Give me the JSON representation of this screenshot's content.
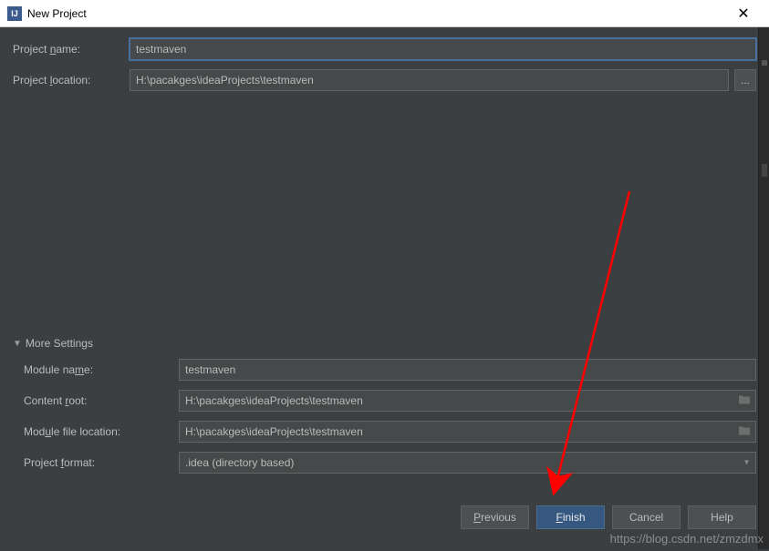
{
  "titlebar": {
    "title": "New Project"
  },
  "fields": {
    "project_name_label": "Project name:",
    "project_name_value": "testmaven",
    "project_location_label": "Project location:",
    "project_location_value": "H:\\pacakges\\ideaProjects\\testmaven",
    "browse_label": "..."
  },
  "more_settings": {
    "header": "More Settings",
    "module_name_label": "Module name:",
    "module_name_value": "testmaven",
    "content_root_label": "Content root:",
    "content_root_value": "H:\\pacakges\\ideaProjects\\testmaven",
    "module_file_location_label": "Module file location:",
    "module_file_location_value": "H:\\pacakges\\ideaProjects\\testmaven",
    "project_format_label": "Project format:",
    "project_format_value": ".idea (directory based)"
  },
  "buttons": {
    "previous": "Previous",
    "finish": "Finish",
    "cancel": "Cancel",
    "help": "Help"
  },
  "watermark": "https://blog.csdn.net/zmzdmx"
}
